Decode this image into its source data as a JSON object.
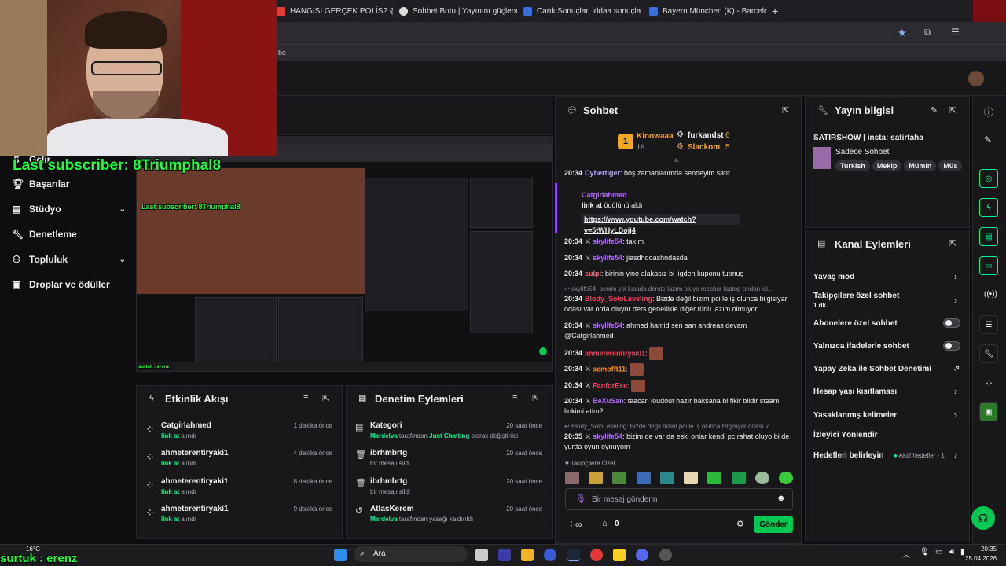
{
  "browser": {
    "tabs": [
      {
        "label": "HANGİSİ GERÇEK POLİS? @Am"
      },
      {
        "label": "Sohbet Botu | Yayınını güçlend"
      },
      {
        "label": "Canlı Sonuçlar, iddaa sonuçlar"
      },
      {
        "label": "Bayern München (K) - Barcelo"
      }
    ],
    "new_tab": "+",
    "bookmark_fragment": "be"
  },
  "sidebar": {
    "items": [
      {
        "label": "Gelir",
        "icon": "money-icon"
      },
      {
        "label": "Başarılar",
        "icon": "trophy-icon"
      },
      {
        "label": "Stüdyo",
        "icon": "studio-icon",
        "chevron": true
      },
      {
        "label": "Denetleme",
        "icon": "wrench-icon"
      },
      {
        "label": "Topluluk",
        "icon": "community-icon",
        "chevron": true
      },
      {
        "label": "Droplar ve ödüller",
        "icon": "gift-icon"
      }
    ]
  },
  "overlay": {
    "last_subscriber": "Last subscriber: 8Triumphal8",
    "preview_last_subscriber": "Last subscriber: 8Triumphal8",
    "bottom_name": "surtuk : erenz",
    "preview_bottom": "surtuk : erenz"
  },
  "activity": {
    "title": "Etkinlik Akışı",
    "rows": [
      {
        "user": "Catgirlahmed",
        "action_hl": "link at",
        "action": "alındı",
        "time": "1 dakika önce"
      },
      {
        "user": "ahmeterentiryaki1",
        "action_hl": "link at",
        "action": "alındı",
        "time": "4 dakika önce"
      },
      {
        "user": "ahmeterentiryaki1",
        "action_hl": "link at",
        "action": "alındı",
        "time": "8 dakika önce"
      },
      {
        "user": "ahmeterentiryaki1",
        "action_hl": "link at",
        "action": "alındı",
        "time": "9 dakika önce"
      }
    ]
  },
  "modlog": {
    "title": "Denetim Eylemleri",
    "rows": [
      {
        "title": "Kategori",
        "line_a": "Mardelva",
        "line_b": " tarafından ",
        "line_c": "Just Chatting",
        "line_d": " olarak değiştirildi",
        "time": "20 saat önce"
      },
      {
        "title": "ibrhmbrtg",
        "line_a": "",
        "line_b": "bir mesajı sildi",
        "line_c": "",
        "line_d": "",
        "time": "20 saat önce"
      },
      {
        "title": "ibrhmbrtg",
        "line_a": "",
        "line_b": "bir mesajı sildi",
        "line_c": "",
        "line_d": "",
        "time": "20 saat önce"
      },
      {
        "title": "AtlasKerem",
        "line_a": "Mardelva",
        "line_b": " tarafından yasağı kaldırıldı",
        "line_c": "",
        "line_d": "",
        "time": "20 saat önce"
      }
    ]
  },
  "chat": {
    "title": "Sohbet",
    "leaders": [
      {
        "rank": "1",
        "name": "Kinowaaa",
        "count": "16"
      },
      {
        "name": "furkandst",
        "count": "6"
      },
      {
        "name": "Slackom",
        "count": "5"
      }
    ],
    "messages": [
      {
        "time": "20:34",
        "user": "Cybertiger",
        "text": ": boş zamanlarımda sendeyim satır"
      },
      {
        "time": "20:34",
        "user": "skylife54",
        "text": ": takım"
      },
      {
        "time": "20:34",
        "user": "skylife54",
        "text": ": jiasdhdoashndasda"
      },
      {
        "time": "20:34",
        "user": "sulpi",
        "text": ": birinin yine alakasız bi ligden kuponu tutmuş"
      },
      {
        "time": "20:34",
        "user": "Blody_SoloLeveling",
        "text": ": Bizde değil bizim pci le iş olunca bilgisiyar odası var orda oluyor ders genellikle diğer türlü lazım olmuyor"
      },
      {
        "time": "20:34",
        "user": "skylife54",
        "text": ": ahmed hamid sen san andreas devam @Catgirlahmed"
      },
      {
        "time": "20:34",
        "user": "ahmeterentiryaki1",
        "text": ":"
      },
      {
        "time": "20:34",
        "user": "semofft11",
        "text": ":"
      },
      {
        "time": "20:34",
        "user": "FanforExe",
        "text": ":"
      },
      {
        "time": "20:34",
        "user": "BeXuSan",
        "text": ": taacan loudout hazır baksana bi fikir bildir steam linkimi atim?"
      },
      {
        "time": "20:35",
        "user": "skylife54",
        "text": ": bizim de var da eski onlar kendi pc rahat oluyo bi de yurtta oyun oynuyom"
      }
    ],
    "redeem": {
      "user": "Catgirlahmed",
      "reward_title": "link at",
      "reward_text": " ödülünü aldı",
      "link": "https://www.youtube.com/watch?v=5tWHyLDojj4"
    },
    "reply1": "skylife54: benim yol kısada derste lazım oluyo mecbur laptop ondan isi...",
    "reply2": "Blody_SoloLeveling: Bizde değil bizim pci le iş olunca bilgisiyar odası v...",
    "followers_only": "Takipçilere Özel",
    "input_placeholder": "Bir mesaj gönderin",
    "points": "0",
    "send": "Gönder"
  },
  "streaminfo": {
    "title": "Yayın bilgisi",
    "stream_title": "SATIRSHOW | insta: satirtaha",
    "category": "Sadece Sohbet",
    "tags": [
      "Turkish",
      "Mekip",
      "Mümin",
      "Müs"
    ]
  },
  "channel_actions": {
    "title": "Kanal Eylemleri",
    "items": [
      {
        "label": "Yavaş mod",
        "control": "chevron"
      },
      {
        "label": "Takipçilere özel sohbet",
        "sub": "1 dk.",
        "control": "chevron"
      },
      {
        "label": "Abonelere özel sohbet",
        "control": "toggle"
      },
      {
        "label": "Yalnızca ifadelerle sohbet",
        "control": "toggle"
      },
      {
        "label": "Yapay Zeka ile Sohbet Denetimi",
        "control": "external"
      },
      {
        "label": "Hesap yaşı kısıtlaması",
        "control": "chevron"
      },
      {
        "label": "Yasaklanmış kelimeler",
        "control": "chevron"
      },
      {
        "label": "İzleyici Yönlendir",
        "control": "none"
      },
      {
        "label": "Hedefleri belirleyin",
        "status": "Aktif hedefler - 1",
        "control": "chevron"
      }
    ]
  },
  "taskbar": {
    "weather_temp": "16°C",
    "search": "Ara",
    "time": "20:35",
    "date": "25.04.2026"
  },
  "colors": {
    "twitch_green": "#00f593",
    "overlay_green": "#1bff3c",
    "panel_bg": "#18181b",
    "page_bg": "#0e0e10"
  }
}
